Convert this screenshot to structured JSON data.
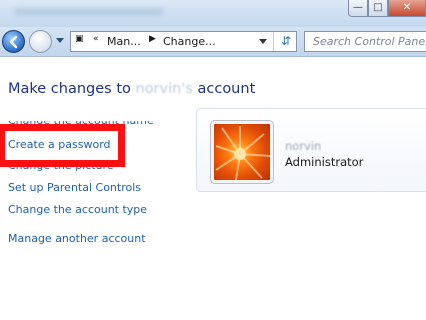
{
  "toolbar": {
    "address_segments": [
      "Man...",
      "Change..."
    ],
    "search_placeholder": "Search Control Panel"
  },
  "main": {
    "heading_prefix": "Make changes to ",
    "heading_user": "norvin's",
    "heading_suffix": " account",
    "links": {
      "change_name": "Change the account name",
      "create_password": "Create a password",
      "change_picture": "Change the picture",
      "parental_controls": "Set up Parental Controls",
      "change_type": "Change the account type",
      "manage_another": "Manage another account"
    }
  },
  "user_card": {
    "name": "norvin",
    "role": "Administrator"
  },
  "colors": {
    "link": "#1f5fb0",
    "heading": "#1e3287",
    "highlight": "#ff1010"
  }
}
